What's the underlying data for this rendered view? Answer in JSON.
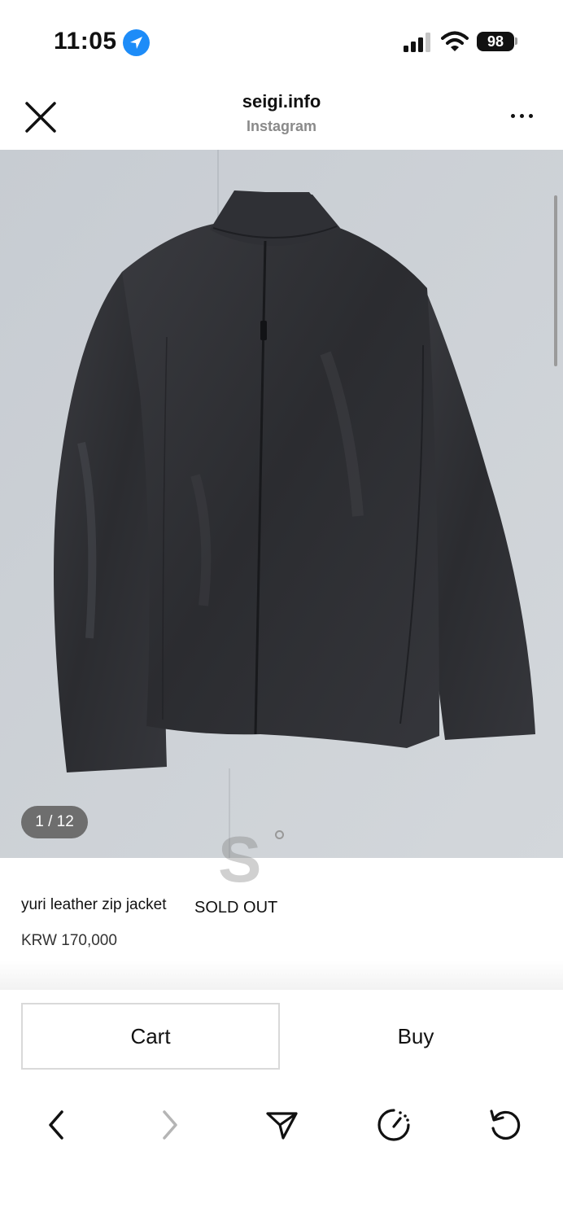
{
  "status_bar": {
    "time": "11:05",
    "battery": "98"
  },
  "header": {
    "site": "seigi.info",
    "source": "Instagram"
  },
  "photo": {
    "counter": "1 / 12",
    "watermark": "S"
  },
  "product": {
    "name": "yuri leather zip jacket",
    "status": "SOLD OUT",
    "price": "KRW 170,000"
  },
  "actions": {
    "cart": "Cart",
    "buy": "Buy"
  },
  "toolbar": {
    "icons": [
      "back-icon",
      "forward-icon",
      "share-icon",
      "speed-icon",
      "reload-icon"
    ]
  },
  "colors": {
    "location_accent": "#1d8cf8",
    "photo_background": "#cbd0d5"
  }
}
